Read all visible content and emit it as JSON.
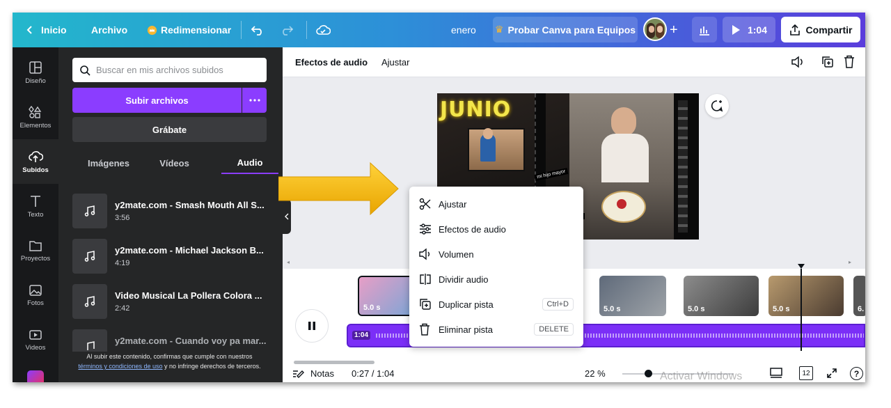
{
  "topbar": {
    "home": "Inicio",
    "file": "Archivo",
    "resize": "Redimensionar",
    "design_name": "enero",
    "try_teams": "Probar Canva para Equipos",
    "play_time": "1:04",
    "share": "Compartir"
  },
  "rail": {
    "items": [
      {
        "label": "Diseño",
        "icon": "layout-icon"
      },
      {
        "label": "Elementos",
        "icon": "shapes-icon"
      },
      {
        "label": "Subidos",
        "icon": "cloud-upload-icon"
      },
      {
        "label": "Texto",
        "icon": "text-icon"
      },
      {
        "label": "Proyectos",
        "icon": "folder-icon"
      },
      {
        "label": "Fotos",
        "icon": "image-icon"
      },
      {
        "label": "Videos",
        "icon": "video-icon"
      }
    ]
  },
  "panel": {
    "search_placeholder": "Buscar en mis archivos subidos",
    "upload_label": "Subir archivos",
    "record_label": "Grábate",
    "tabs": [
      "Imágenes",
      "Vídeos",
      "Audio"
    ],
    "tracks": [
      {
        "title": "y2mate.com - Smash Mouth All S...",
        "duration": "3:56"
      },
      {
        "title": "y2mate.com - Michael Jackson B...",
        "duration": "4:19"
      },
      {
        "title": "Video Musical La Pollera Colora ...",
        "duration": "2:42"
      },
      {
        "title": "y2mate.com - Cuando voy pa mar...",
        "duration": ""
      }
    ],
    "terms_before": "Al subir este contenido, confirmas que cumple con nuestros",
    "terms_link": "términos y condiciones de uso",
    "terms_after": "y no infringe derechos de terceros."
  },
  "editor": {
    "toolbar": {
      "audio_effects": "Efectos de audio",
      "adjust": "Ajustar"
    },
    "canvas_text": {
      "junio": "JUNIO",
      "caption1": "mi hijo mayor",
      "caption2": "nado"
    },
    "clips": [
      {
        "duration": "5.0 s"
      },
      {
        "duration": "5.0 s"
      },
      {
        "duration": "5.0 s"
      },
      {
        "duration": "5.0 s"
      },
      {
        "duration": "6."
      }
    ],
    "audio_badge": "1:04",
    "status": {
      "notes": "Notas",
      "time": "0:27 / 1:04",
      "zoom": "22 %",
      "watermark": "Activar Windows",
      "pages": "12"
    }
  },
  "context_menu": {
    "items": [
      {
        "label": "Ajustar",
        "icon": "scissors-icon",
        "shortcut": ""
      },
      {
        "label": "Efectos de audio",
        "icon": "sliders-icon",
        "shortcut": ""
      },
      {
        "label": "Volumen",
        "icon": "speaker-icon",
        "shortcut": ""
      },
      {
        "label": "Dividir audio",
        "icon": "split-icon",
        "shortcut": ""
      },
      {
        "label": "Duplicar pista",
        "icon": "duplicate-icon",
        "shortcut": "Ctrl+D"
      },
      {
        "label": "Eliminar pista",
        "icon": "trash-icon",
        "shortcut": "DELETE"
      }
    ]
  },
  "colors": {
    "accent": "#8b3dff",
    "arrow": "#f5b700",
    "audio_track": "#7b2ff7"
  }
}
